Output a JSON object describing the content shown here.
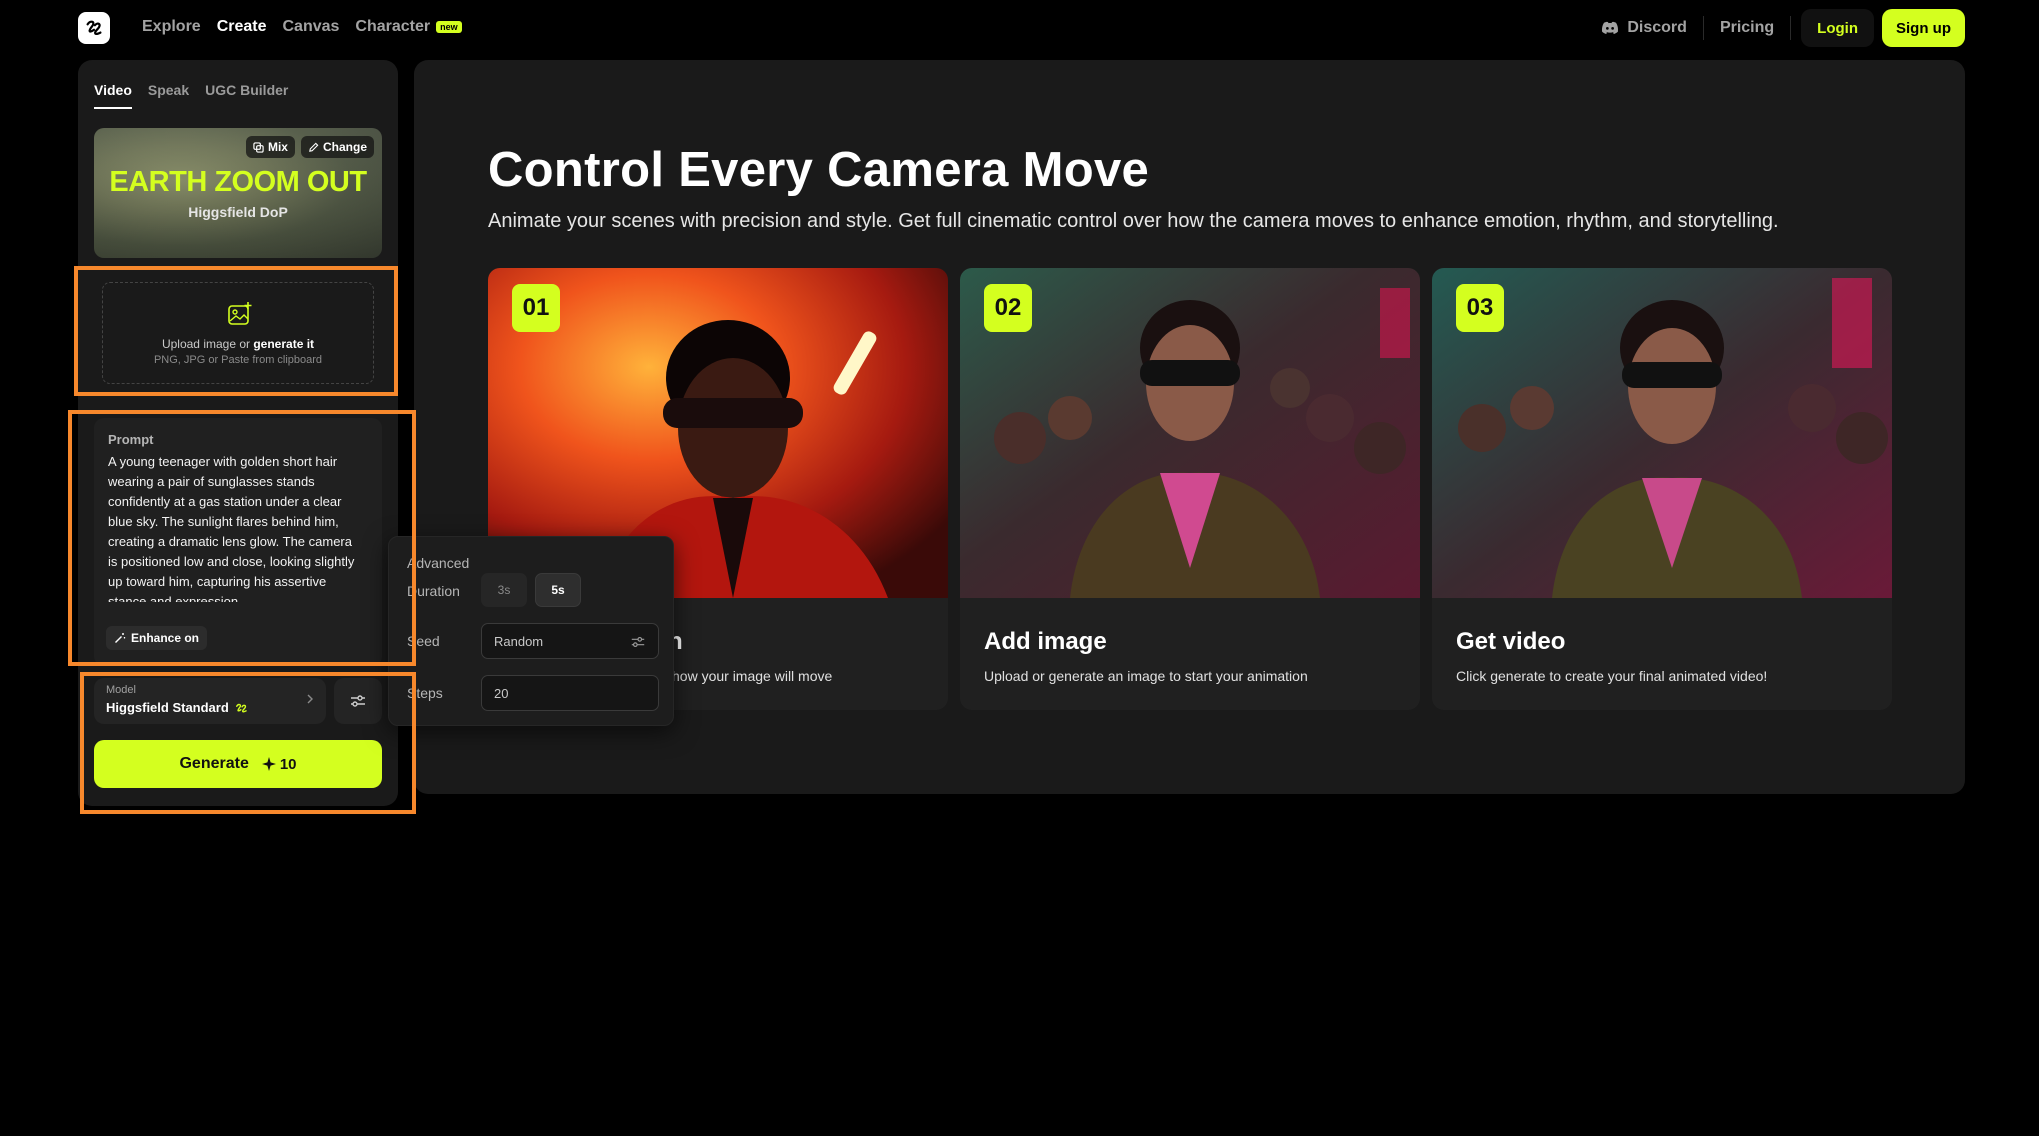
{
  "nav": {
    "links": [
      "Explore",
      "Create",
      "Canvas",
      "Character"
    ],
    "new_badge": "new",
    "discord": "Discord",
    "pricing": "Pricing",
    "login": "Login",
    "signup": "Sign up"
  },
  "panel": {
    "tabs": [
      "Video",
      "Speak",
      "UGC Builder"
    ],
    "preset": {
      "title": "EARTH ZOOM OUT",
      "subtitle": "Higgsfield DoP",
      "mix": "Mix",
      "change": "Change"
    },
    "upload": {
      "text_prefix": "Upload image or ",
      "text_link": "generate it",
      "hint": "PNG, JPG or Paste from clipboard"
    },
    "prompt": {
      "label": "Prompt",
      "text": "A young teenager with golden short hair wearing a pair of sunglasses stands confidently at a gas station under a clear blue sky. The sunlight flares behind him, creating a dramatic lens glow. The camera is positioned low and close, looking slightly up toward him, capturing his assertive stance and expression.",
      "enhance": "Enhance on"
    },
    "model": {
      "label": "Model",
      "name": "Higgsfield Standard"
    },
    "generate": {
      "label": "Generate",
      "cost": "10"
    }
  },
  "main": {
    "title": "Control Every Camera Move",
    "subtitle": "Animate your scenes with precision and style. Get full cinematic control over how the camera moves to enhance emotion, rhythm, and storytelling.",
    "steps": [
      {
        "num": "01",
        "title": "n",
        "desc": "how your image will move"
      },
      {
        "num": "02",
        "title": "Add image",
        "desc": "Upload or generate an image to start your animation"
      },
      {
        "num": "03",
        "title": "Get video",
        "desc": "Click generate to create your final animated video!"
      }
    ]
  },
  "advanced": {
    "title": "Advanced",
    "duration_label": "Duration",
    "durations": [
      "3s",
      "5s"
    ],
    "seed_label": "Seed",
    "seed_value": "Random",
    "steps_label": "Steps",
    "steps_value": "20"
  },
  "colors": {
    "accent": "#d4ff1f",
    "highlight": "#f7882c",
    "panel": "#1a1a1a"
  }
}
